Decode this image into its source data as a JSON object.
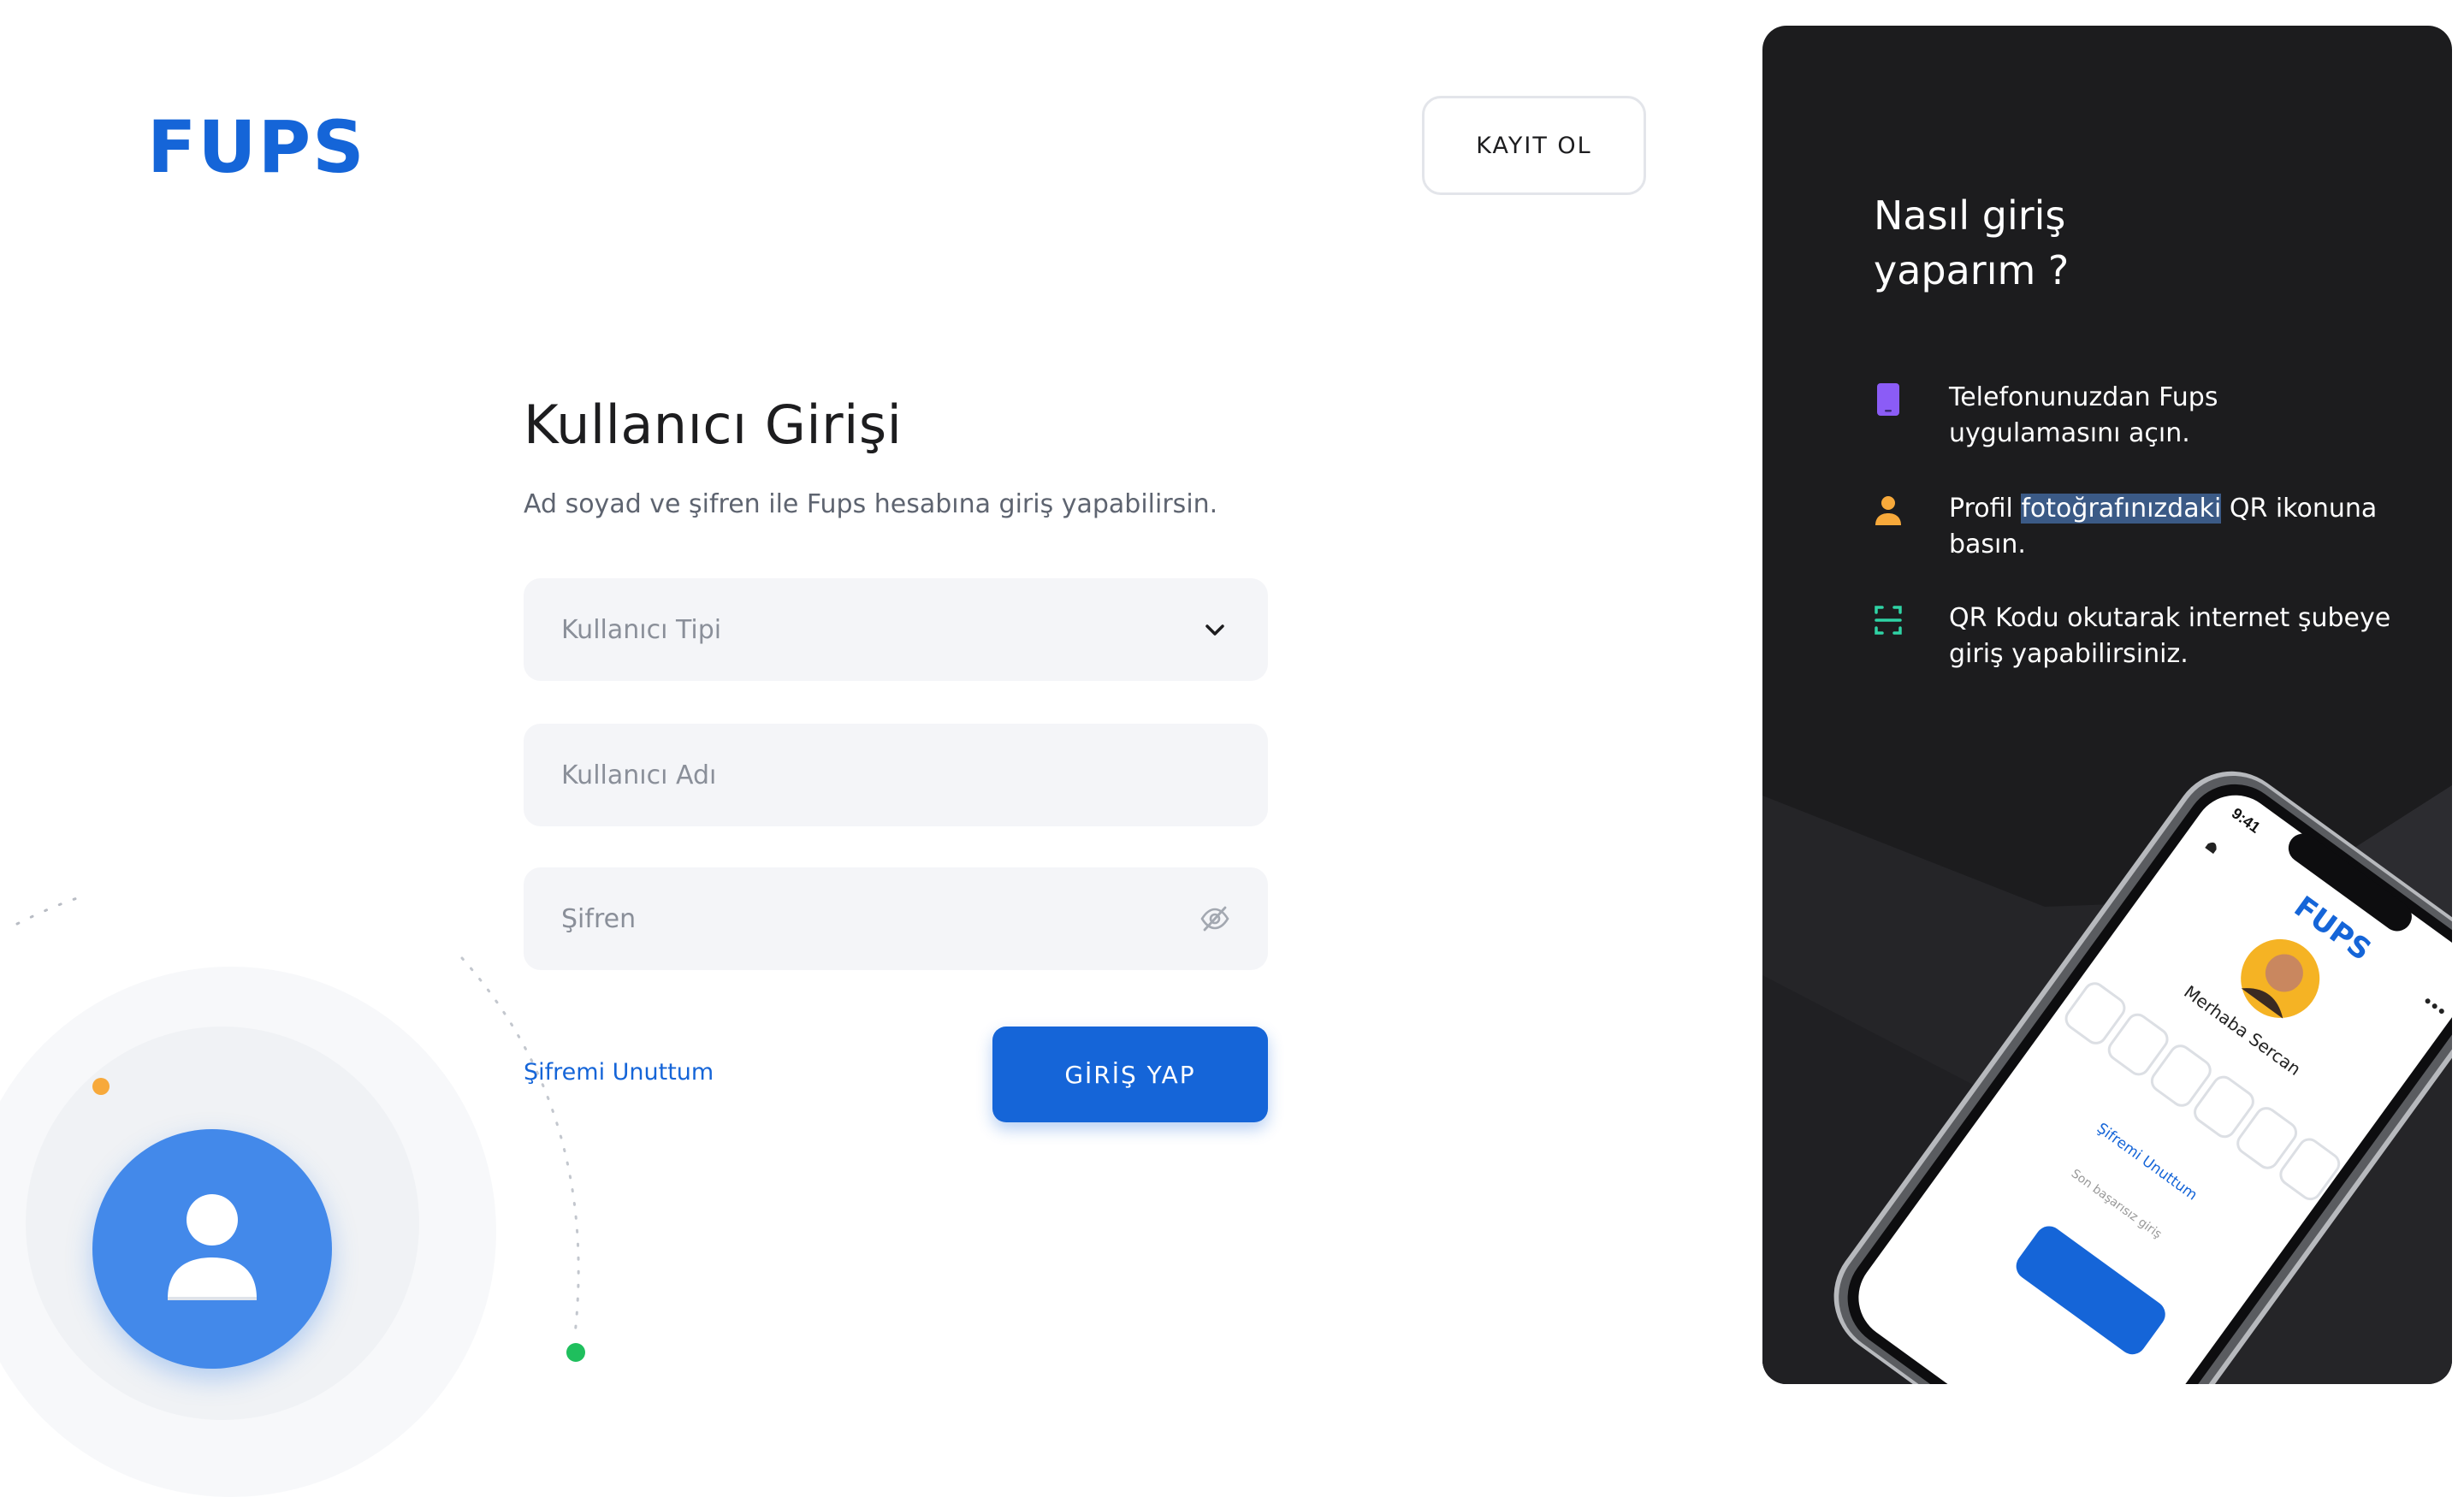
{
  "header": {
    "logo_text": "FUPS",
    "register_label": "KAYIT OL"
  },
  "login": {
    "title": "Kullanıcı Girişi",
    "subtitle": "Ad soyad ve şifren ile Fups hesabına giriş yapabilirsin.",
    "user_type_placeholder": "Kullanıcı Tipi",
    "username_placeholder": "Kullanıcı Adı",
    "password_placeholder": "Şifren",
    "forgot_label": "Şifremi Unuttum",
    "submit_label": "GİRİŞ YAP"
  },
  "info": {
    "title": "Nasıl giriş yaparım ?",
    "steps": [
      {
        "icon": "phone-icon",
        "color": "#8b5cf6",
        "text": "Telefonunuzdan Fups uygulamasını açın."
      },
      {
        "icon": "user-icon",
        "color": "#f7a93b",
        "text_before": "Profil ",
        "text_highlight": "fotoğrafınızdaki",
        "text_after": " QR ikonuna basın."
      },
      {
        "icon": "qr-scan-icon",
        "color": "#2fd3a5",
        "text": "QR Kodu okutarak internet şubeye giriş yapabilirsiniz."
      }
    ]
  },
  "phone_mockup": {
    "time": "9:41",
    "logo_text": "FUPS",
    "greeting": "Merhaba Sercan",
    "forgot_label": "Şifremi Unuttum",
    "footer_text": "Son başarısız giriş"
  },
  "colors": {
    "brand_blue": "#1565d8",
    "panel_dark": "#1c1c1e",
    "avatar_blue": "#4389ea",
    "accent_orange": "#f7a93b",
    "accent_green": "#1fbf5d"
  }
}
